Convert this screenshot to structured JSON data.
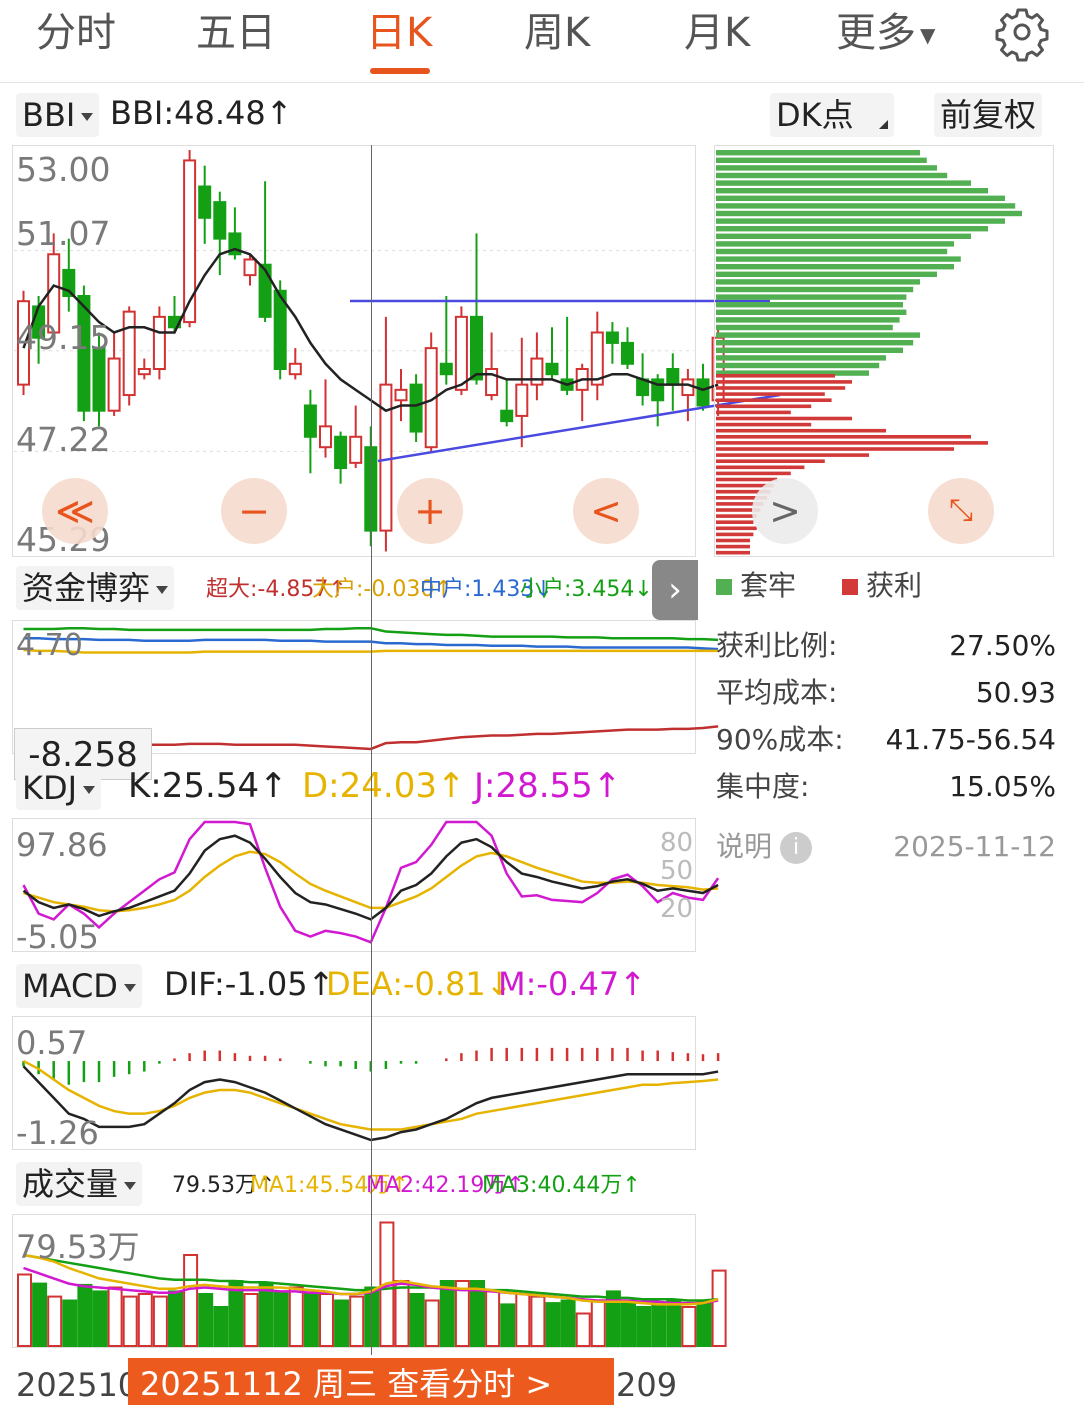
{
  "tabs": [
    {
      "label": "分时"
    },
    {
      "label": "五日"
    },
    {
      "label": "日K"
    },
    {
      "label": "周K"
    },
    {
      "label": "月K"
    },
    {
      "label": "更多"
    }
  ],
  "active_tab": "日K",
  "settings_icon": "gear-icon",
  "bbi": {
    "selector": "BBI",
    "value": "BBI:48.48↑"
  },
  "dk_button": "DK点",
  "adjust_button": "前复权",
  "price_axis": [
    "53.00",
    "51.07",
    "49.15",
    "47.22",
    "45.29"
  ],
  "controls": {
    "zoom_out_fast": "≪",
    "zoom_out": "−",
    "zoom_in": "+",
    "prev": "<",
    "next": ">",
    "expand_icon": "expand-icon"
  },
  "fund": {
    "selector": "资金博弈",
    "super": "超大:-4.857↑",
    "large": "大户:-0.030↑",
    "medium": "中户:1.433↓",
    "small": "小户:3.454↓",
    "axis_top": "4.70",
    "tooltip": "-8.258"
  },
  "chip_legend": {
    "trapped": "套牢",
    "profit": "获利"
  },
  "chip_stats": [
    {
      "label": "获利比例:",
      "value": "27.50%"
    },
    {
      "label": "平均成本:",
      "value": "50.93"
    },
    {
      "label": "90%成本:",
      "value": "41.75-56.54"
    },
    {
      "label": "集中度:",
      "value": "15.05%"
    }
  ],
  "chip_note": {
    "label": "说明",
    "date": "2025-11-12"
  },
  "kdj": {
    "selector": "KDJ",
    "k": "K:25.54↑",
    "d": "D:24.03↑",
    "j": "J:28.55↑",
    "axis_top": "97.86",
    "axis_bottom": "-5.05",
    "levels": [
      "80",
      "50",
      "20"
    ]
  },
  "macd": {
    "selector": "MACD",
    "dif": "DIF:-1.05↑",
    "dea": "DEA:-0.81↓",
    "m": "M:-0.47↑",
    "axis_top": "0.57",
    "axis_bottom": "-1.26"
  },
  "volume": {
    "selector": "成交量",
    "value": "79.53万↑",
    "ma1": "MA1:45.54万↑",
    "ma2": "MA2:42.19万↑",
    "ma3": "MA3:40.44万↑",
    "axis_top": "79.53万"
  },
  "date_axis": {
    "left": "202510",
    "right": "209"
  },
  "date_banner": "20251112 周三 查看分时 >",
  "colors": {
    "accent": "#e8541e",
    "up": "#d23232",
    "down": "#14a014",
    "ma": "#222222",
    "line_blue": "#4a4ae0",
    "kdj_k": "#222222",
    "kdj_d": "#e6b400",
    "kdj_j": "#d219d2"
  },
  "chart_data": {
    "type": "candlestick",
    "ylim": [
      45.29,
      53.0
    ],
    "candles": [
      {
        "o": 48.5,
        "c": 50.1,
        "h": 50.3,
        "l": 48.3
      },
      {
        "o": 50.0,
        "c": 49.4,
        "h": 50.2,
        "l": 48.9
      },
      {
        "o": 49.5,
        "c": 51.0,
        "h": 51.4,
        "l": 49.3
      },
      {
        "o": 50.7,
        "c": 50.2,
        "h": 51.3,
        "l": 49.9
      },
      {
        "o": 50.2,
        "c": 48.0,
        "h": 50.4,
        "l": 47.8
      },
      {
        "o": 49.2,
        "c": 48.0,
        "h": 49.5,
        "l": 47.7
      },
      {
        "o": 48.0,
        "c": 49.0,
        "h": 49.5,
        "l": 47.9
      },
      {
        "o": 48.3,
        "c": 49.9,
        "h": 50.0,
        "l": 48.1
      },
      {
        "o": 48.7,
        "c": 48.8,
        "h": 49.0,
        "l": 48.6
      },
      {
        "o": 48.8,
        "c": 49.8,
        "h": 50.0,
        "l": 48.6
      },
      {
        "o": 49.8,
        "c": 49.6,
        "h": 50.2,
        "l": 49.5
      },
      {
        "o": 49.7,
        "c": 52.8,
        "h": 53.0,
        "l": 49.6
      },
      {
        "o": 52.3,
        "c": 51.7,
        "h": 52.7,
        "l": 51.2
      },
      {
        "o": 52.0,
        "c": 51.3,
        "h": 52.2,
        "l": 50.6
      },
      {
        "o": 51.4,
        "c": 51.0,
        "h": 51.9,
        "l": 50.9
      },
      {
        "o": 50.6,
        "c": 50.9,
        "h": 51.0,
        "l": 50.4
      },
      {
        "o": 50.8,
        "c": 49.8,
        "h": 52.4,
        "l": 49.7
      },
      {
        "o": 50.3,
        "c": 48.8,
        "h": 50.5,
        "l": 48.6
      },
      {
        "o": 48.7,
        "c": 48.9,
        "h": 49.2,
        "l": 48.6
      },
      {
        "o": 48.1,
        "c": 47.5,
        "h": 48.4,
        "l": 46.8
      },
      {
        "o": 47.3,
        "c": 47.7,
        "h": 48.6,
        "l": 47.1
      },
      {
        "o": 47.5,
        "c": 46.9,
        "h": 47.6,
        "l": 46.6
      },
      {
        "o": 47.0,
        "c": 47.5,
        "h": 48.1,
        "l": 46.9
      },
      {
        "o": 47.3,
        "c": 45.7,
        "h": 47.7,
        "l": 45.4
      },
      {
        "o": 45.7,
        "c": 48.5,
        "h": 49.8,
        "l": 45.3
      },
      {
        "o": 48.2,
        "c": 48.4,
        "h": 48.8,
        "l": 47.8
      },
      {
        "o": 48.5,
        "c": 47.6,
        "h": 48.7,
        "l": 47.4
      },
      {
        "o": 47.3,
        "c": 49.2,
        "h": 49.5,
        "l": 47.2
      },
      {
        "o": 48.9,
        "c": 48.7,
        "h": 50.2,
        "l": 48.5
      },
      {
        "o": 48.4,
        "c": 49.8,
        "h": 50.0,
        "l": 48.3
      },
      {
        "o": 49.8,
        "c": 48.6,
        "h": 51.4,
        "l": 48.5
      },
      {
        "o": 48.3,
        "c": 48.8,
        "h": 49.5,
        "l": 48.2
      },
      {
        "o": 48.0,
        "c": 47.8,
        "h": 48.6,
        "l": 47.7
      },
      {
        "o": 47.9,
        "c": 48.5,
        "h": 49.4,
        "l": 47.3
      },
      {
        "o": 48.5,
        "c": 49.0,
        "h": 49.5,
        "l": 48.2
      },
      {
        "o": 48.9,
        "c": 48.7,
        "h": 49.6,
        "l": 48.6
      },
      {
        "o": 48.6,
        "c": 48.4,
        "h": 49.8,
        "l": 48.3
      },
      {
        "o": 48.4,
        "c": 48.8,
        "h": 48.9,
        "l": 47.8
      },
      {
        "o": 48.5,
        "c": 49.5,
        "h": 49.9,
        "l": 48.2
      },
      {
        "o": 49.5,
        "c": 49.3,
        "h": 49.7,
        "l": 48.9
      },
      {
        "o": 49.3,
        "c": 48.9,
        "h": 49.6,
        "l": 48.8
      },
      {
        "o": 48.6,
        "c": 48.3,
        "h": 49.1,
        "l": 48.1
      },
      {
        "o": 48.6,
        "c": 48.2,
        "h": 48.7,
        "l": 47.7
      },
      {
        "o": 48.8,
        "c": 48.5,
        "h": 49.1,
        "l": 48.0
      },
      {
        "o": 48.3,
        "c": 48.6,
        "h": 48.8,
        "l": 47.8
      },
      {
        "o": 48.6,
        "c": 48.1,
        "h": 48.9,
        "l": 48.0
      },
      {
        "o": 48.2,
        "c": 49.4,
        "h": 49.6,
        "l": 47.9
      }
    ],
    "bbi": [
      49.2,
      50.0,
      50.4,
      50.3,
      50.0,
      49.7,
      49.5,
      49.6,
      49.6,
      49.5,
      49.5,
      50.1,
      50.6,
      51.0,
      51.1,
      51.0,
      50.7,
      50.2,
      49.8,
      49.3,
      48.9,
      48.6,
      48.4,
      48.2,
      48.0,
      48.1,
      48.1,
      48.2,
      48.4,
      48.5,
      48.7,
      48.7,
      48.6,
      48.6,
      48.6,
      48.6,
      48.5,
      48.6,
      48.6,
      48.7,
      48.7,
      48.6,
      48.5,
      48.5,
      48.5,
      48.4,
      48.5
    ],
    "kdj_k": [
      40,
      30,
      25,
      28,
      24,
      18,
      22,
      25,
      30,
      35,
      40,
      55,
      75,
      85,
      88,
      82,
      68,
      52,
      38,
      30,
      28,
      24,
      20,
      15,
      25,
      40,
      45,
      55,
      70,
      82,
      85,
      78,
      65,
      55,
      52,
      48,
      45,
      42,
      44,
      48,
      50,
      46,
      40,
      42,
      40,
      38,
      45
    ],
    "kdj_d": [
      38,
      34,
      30,
      28,
      26,
      23,
      22,
      23,
      25,
      28,
      32,
      40,
      52,
      62,
      70,
      74,
      72,
      65,
      55,
      46,
      40,
      35,
      30,
      25,
      25,
      30,
      35,
      42,
      52,
      62,
      70,
      73,
      70,
      65,
      60,
      56,
      52,
      48,
      47,
      47,
      48,
      47,
      45,
      44,
      43,
      41,
      42
    ],
    "kdj_j": [
      45,
      20,
      15,
      28,
      20,
      8,
      20,
      30,
      40,
      50,
      56,
      85,
      100,
      100,
      100,
      98,
      60,
      26,
      5,
      0,
      5,
      3,
      0,
      -5,
      25,
      60,
      65,
      80,
      100,
      100,
      100,
      88,
      55,
      35,
      36,
      32,
      31,
      30,
      38,
      50,
      54,
      44,
      30,
      38,
      34,
      32,
      51
    ],
    "macd_dif": [
      -0.1,
      -0.4,
      -0.7,
      -1.0,
      -1.1,
      -1.25,
      -1.25,
      -1.25,
      -1.2,
      -1.0,
      -0.8,
      -0.55,
      -0.4,
      -0.35,
      -0.4,
      -0.5,
      -0.6,
      -0.75,
      -0.9,
      -1.05,
      -1.2,
      -1.3,
      -1.4,
      -1.5,
      -1.45,
      -1.35,
      -1.3,
      -1.2,
      -1.1,
      -0.95,
      -0.8,
      -0.7,
      -0.65,
      -0.6,
      -0.55,
      -0.5,
      -0.45,
      -0.4,
      -0.35,
      -0.3,
      -0.25,
      -0.25,
      -0.25,
      -0.25,
      -0.25,
      -0.25,
      -0.2
    ],
    "macd_dea": [
      0.0,
      -0.15,
      -0.35,
      -0.55,
      -0.7,
      -0.85,
      -0.95,
      -1.0,
      -1.0,
      -0.95,
      -0.85,
      -0.7,
      -0.6,
      -0.55,
      -0.55,
      -0.6,
      -0.7,
      -0.8,
      -0.9,
      -1.0,
      -1.1,
      -1.2,
      -1.25,
      -1.3,
      -1.3,
      -1.3,
      -1.25,
      -1.2,
      -1.15,
      -1.1,
      -1.0,
      -0.95,
      -0.9,
      -0.85,
      -0.8,
      -0.75,
      -0.7,
      -0.65,
      -0.6,
      -0.55,
      -0.5,
      -0.45,
      -0.45,
      -0.42,
      -0.4,
      -0.38,
      -0.35
    ],
    "volume": [
      55,
      48,
      38,
      35,
      47,
      42,
      45,
      38,
      40,
      38,
      42,
      70,
      40,
      30,
      50,
      40,
      48,
      42,
      45,
      40,
      40,
      35,
      38,
      45,
      95,
      50,
      40,
      35,
      50,
      50,
      50,
      42,
      32,
      40,
      38,
      33,
      35,
      25,
      35,
      42,
      35,
      30,
      32,
      35,
      30,
      35,
      58
    ],
    "vol_ma1": [
      70,
      68,
      65,
      60,
      56,
      52,
      50,
      48,
      46,
      44,
      44,
      46,
      47,
      46,
      45,
      45,
      45,
      45,
      44,
      43,
      42,
      40,
      40,
      42,
      48,
      50,
      48,
      46,
      45,
      44,
      44,
      43,
      41,
      40,
      39,
      38,
      37,
      35,
      34,
      34,
      34,
      33,
      32,
      32,
      32,
      33,
      36
    ],
    "vol_ma2": [
      60,
      56,
      52,
      48,
      46,
      45,
      44,
      43,
      42,
      41,
      41,
      44,
      45,
      44,
      43,
      43,
      43,
      42,
      42,
      41,
      41,
      40,
      40,
      41,
      46,
      48,
      47,
      45,
      44,
      43,
      43,
      42,
      41,
      40,
      39,
      38,
      37,
      36,
      35,
      35,
      35,
      34,
      34,
      33,
      33,
      33,
      35
    ],
    "vol_ma3": [
      70,
      68,
      66,
      64,
      62,
      60,
      58,
      56,
      54,
      52,
      51,
      51,
      51,
      50,
      50,
      49,
      49,
      48,
      47,
      46,
      45,
      44,
      43,
      43,
      44,
      45,
      45,
      45,
      44,
      44,
      44,
      43,
      43,
      42,
      41,
      40,
      39,
      38,
      38,
      37,
      37,
      36,
      36,
      36,
      35,
      35,
      36
    ],
    "fund_super": [
      -8.6,
      -8.4,
      -8.3,
      -8.2,
      -8.1,
      -8.1,
      -8.0,
      -8.0,
      -7.9,
      -7.9,
      -7.9,
      -7.8,
      -7.8,
      -7.8,
      -7.9,
      -7.9,
      -7.9,
      -7.9,
      -7.9,
      -8.0,
      -8.1,
      -8.2,
      -8.3,
      -8.4,
      -7.7,
      -7.6,
      -7.6,
      -7.4,
      -7.2,
      -7.0,
      -6.9,
      -6.8,
      -6.8,
      -6.7,
      -6.6,
      -6.6,
      -6.5,
      -6.4,
      -6.3,
      -6.2,
      -6.1,
      -6.1,
      -6.1,
      -6.0,
      -6.0,
      -5.9,
      -5.7
    ],
    "fund_large": [
      3.4,
      3.3,
      3.3,
      3.2,
      3.1,
      3.1,
      3.1,
      3.1,
      3.1,
      3.1,
      3.1,
      3.1,
      3.2,
      3.2,
      3.2,
      3.2,
      3.2,
      3.2,
      3.2,
      3.2,
      3.2,
      3.2,
      3.2,
      3.2,
      3.3,
      3.3,
      3.3,
      3.3,
      3.3,
      3.3,
      3.3,
      3.3,
      3.3,
      3.3,
      3.3,
      3.3,
      3.3,
      3.3,
      3.3,
      3.3,
      3.3,
      3.3,
      3.3,
      3.3,
      3.3,
      3.3,
      3.3
    ],
    "fund_medium": [
      4.8,
      4.8,
      4.7,
      4.7,
      4.7,
      4.6,
      4.6,
      4.6,
      4.5,
      4.5,
      4.5,
      4.5,
      4.6,
      4.6,
      4.6,
      4.6,
      4.6,
      4.5,
      4.5,
      4.5,
      4.4,
      4.4,
      4.4,
      4.4,
      4.2,
      4.2,
      4.1,
      4.1,
      4.0,
      4.0,
      4.0,
      3.9,
      3.9,
      3.9,
      3.8,
      3.8,
      3.8,
      3.7,
      3.7,
      3.7,
      3.7,
      3.7,
      3.7,
      3.7,
      3.7,
      3.6,
      3.5
    ],
    "fund_small": [
      5.9,
      5.9,
      5.9,
      6.0,
      6.0,
      5.9,
      5.9,
      5.8,
      5.8,
      5.8,
      5.8,
      5.8,
      5.8,
      5.8,
      5.8,
      5.8,
      5.8,
      5.8,
      5.8,
      5.8,
      5.9,
      5.9,
      6.0,
      6.0,
      5.6,
      5.5,
      5.4,
      5.3,
      5.2,
      5.2,
      5.1,
      5.0,
      5.0,
      5.0,
      5.0,
      5.0,
      4.9,
      4.9,
      4.9,
      4.8,
      4.8,
      4.8,
      4.8,
      4.8,
      4.7,
      4.7,
      4.6
    ],
    "chip_trapped": [
      0.6,
      0.62,
      0.65,
      0.68,
      0.75,
      0.8,
      0.85,
      0.88,
      0.9,
      0.85,
      0.8,
      0.75,
      0.7,
      0.68,
      0.72,
      0.7,
      0.65,
      0.6,
      0.58,
      0.56,
      0.55,
      0.56,
      0.54,
      0.52,
      0.6,
      0.58,
      0.55,
      0.5,
      0.48,
      0.45
    ],
    "chip_profit": [
      0.35,
      0.4,
      0.38,
      0.32,
      0.34,
      0.28,
      0.22,
      0.4,
      0.28,
      0.5,
      0.75,
      0.8,
      0.7,
      0.45,
      0.32,
      0.26,
      0.22,
      0.18,
      0.17,
      0.16,
      0.15,
      0.14,
      0.13,
      0.12,
      0.11,
      0.12,
      0.11,
      0.1,
      0.1,
      0.1
    ]
  }
}
